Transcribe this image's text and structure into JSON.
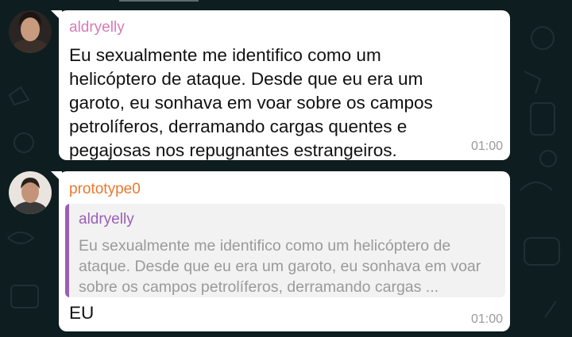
{
  "colors": {
    "background": "#0e1d20",
    "bubble": "#ffffff",
    "sender_1": "#d67bb7",
    "sender_2": "#e8792f",
    "quote_accent": "#9b5fb5"
  },
  "messages": [
    {
      "sender": "aldryelly",
      "text": "Eu sexualmente me identifico como um helicóptero de ataque. Desde que eu era um garoto, eu sonhava em voar sobre os campos petrolíferos, derramando cargas quentes e pegajosas nos repugnantes estrangeiros.",
      "time": "01:00"
    },
    {
      "sender": "prototype0",
      "reply": {
        "author": "aldryelly",
        "text": "Eu sexualmente me identifico como um helicóptero de ataque. Desde que eu era um garoto, eu sonhava em voar sobre os campos petrolíferos, derramando cargas ..."
      },
      "text": "EU",
      "time": "01:00"
    }
  ]
}
